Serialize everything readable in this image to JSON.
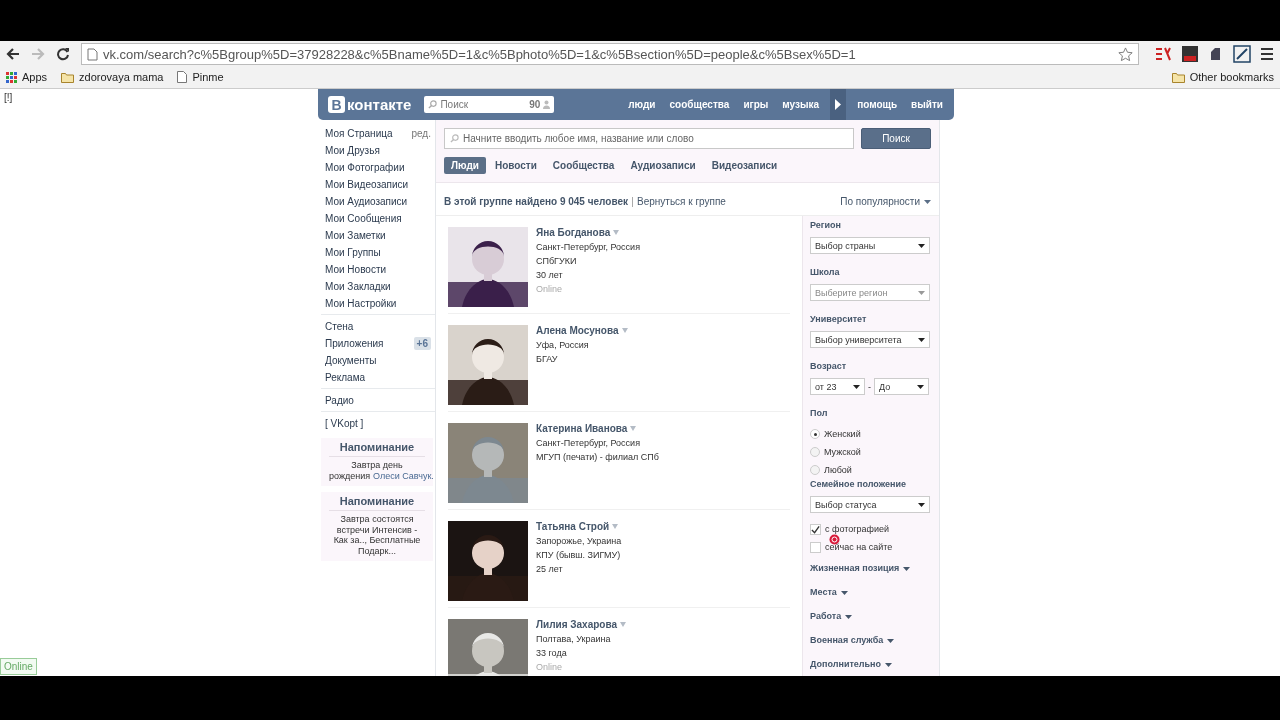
{
  "browser": {
    "url": "vk.com/search?c%5Bgroup%5D=37928228&c%5Bname%5D=1&c%5Bphoto%5D=1&c%5Bsection%5D=people&c%5Bsex%5D=1",
    "bookmarks": [
      {
        "kind": "apps",
        "label": "Apps"
      },
      {
        "kind": "folder",
        "label": "zdorovaya mama"
      },
      {
        "kind": "page",
        "label": "Pinme"
      }
    ],
    "other_bookmarks": "Other bookmarks"
  },
  "page_marker": "[!]",
  "online_badge": "Online",
  "header": {
    "logo_letter": "В",
    "logo_text": "контакте",
    "search_placeholder": "Поиск",
    "search_count": "90",
    "nav": [
      {
        "kind": "link",
        "label": "люди"
      },
      {
        "kind": "link",
        "label": "сообщества"
      },
      {
        "kind": "link",
        "label": "игры"
      },
      {
        "kind": "link",
        "label": "музыка"
      },
      {
        "kind": "arrow"
      },
      {
        "kind": "link",
        "label": "помощь"
      },
      {
        "kind": "link",
        "label": "выйти"
      }
    ]
  },
  "sidebar": {
    "groups": [
      [
        {
          "label": "Моя Страница",
          "extra": "ред."
        },
        {
          "label": "Мои Друзья"
        },
        {
          "label": "Мои Фотографии"
        },
        {
          "label": "Мои Видеозаписи"
        },
        {
          "label": "Мои Аудиозаписи"
        },
        {
          "label": "Мои Сообщения"
        },
        {
          "label": "Мои Заметки"
        },
        {
          "label": "Мои Группы"
        },
        {
          "label": "Мои Новости"
        },
        {
          "label": "Мои Закладки"
        },
        {
          "label": "Мои Настройки"
        }
      ],
      [
        {
          "label": "Стена"
        },
        {
          "label": "Приложения",
          "badge": "+6"
        },
        {
          "label": "Документы"
        },
        {
          "label": "Реклама"
        }
      ],
      [
        {
          "label": "Радио"
        }
      ],
      [
        {
          "label": "[ VKopt ]"
        }
      ]
    ],
    "reminders": [
      {
        "title": "Напоминание",
        "text": "Завтра день рождения",
        "link": "Олеси Савчук."
      },
      {
        "title": "Напоминание",
        "text": "Завтра состоятся встречи Интенсив - Как за.., Бесплатные Подарк..."
      }
    ]
  },
  "search": {
    "placeholder": "Начните вводить любое имя, название или слово",
    "button": "Поиск"
  },
  "tabs": [
    {
      "label": "Люди",
      "selected": true
    },
    {
      "label": "Новости",
      "selected": false
    },
    {
      "label": "Сообщества",
      "selected": false
    },
    {
      "label": "Аудиозаписи",
      "selected": false
    },
    {
      "label": "Видеозаписи",
      "selected": false
    }
  ],
  "summary": {
    "found": "В этой группе найдено 9 045 человек",
    "back_link": "Вернуться к группе",
    "sort": "По популярности"
  },
  "results": [
    {
      "name": "Яна Богданова",
      "lines": [
        "Санкт-Петербург, Россия",
        "СПбГУКИ",
        "30 лет"
      ],
      "status": "Online"
    },
    {
      "name": "Алена Мосунова",
      "lines": [
        "Уфа, Россия",
        "БГАУ"
      ]
    },
    {
      "name": "Катерина Иванова",
      "lines": [
        "Санкт-Петербург, Россия",
        "МГУП (печати) - филиал СПб"
      ]
    },
    {
      "name": "Татьяна Строй",
      "lines": [
        "Запорожье, Украина",
        "КПУ (бывш. ЗИГМУ)",
        "25 лет"
      ]
    },
    {
      "name": "Лилия Захарова",
      "lines": [
        "Полтава, Украина",
        "33 года"
      ],
      "status": "Online"
    }
  ],
  "filters": [
    {
      "kind": "select",
      "label": "Регион",
      "value": "Выбор страны",
      "disabled": false
    },
    {
      "kind": "select",
      "label": "Школа",
      "value": "Выберите регион",
      "disabled": true
    },
    {
      "kind": "select",
      "label": "Университет",
      "value": "Выбор университета",
      "disabled": false
    },
    {
      "kind": "range",
      "label": "Возраст",
      "from": "от 23",
      "dash": "-",
      "to": "До"
    },
    {
      "kind": "radio",
      "label": "Пол",
      "options": [
        {
          "label": "Женский",
          "selected": true
        },
        {
          "label": "Мужской",
          "selected": false
        },
        {
          "label": "Любой",
          "selected": false
        }
      ]
    },
    {
      "kind": "select",
      "label": "Семейное положение",
      "value": "Выбор статуса",
      "disabled": false
    },
    {
      "kind": "checks",
      "options": [
        {
          "label": "с фотографией",
          "checked": true
        },
        {
          "label": "сейчас на сайте",
          "checked": false
        }
      ]
    },
    {
      "kind": "collapsed",
      "label": "Жизненная позиция"
    },
    {
      "kind": "collapsed",
      "label": "Места"
    },
    {
      "kind": "collapsed",
      "label": "Работа"
    },
    {
      "kind": "collapsed",
      "label": "Военная служба"
    },
    {
      "kind": "collapsed",
      "label": "Дополнительно"
    }
  ]
}
